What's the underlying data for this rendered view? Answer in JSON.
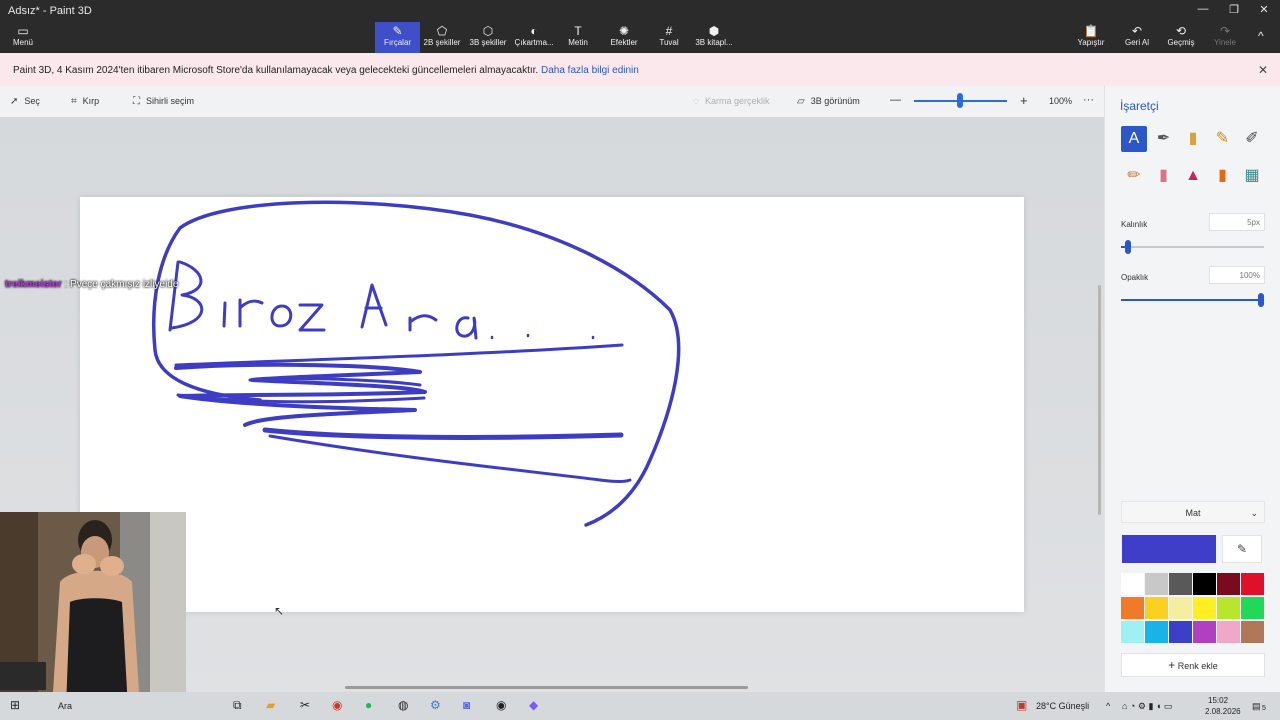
{
  "window": {
    "title": "Adsız* - Paint 3D",
    "minimize": "—",
    "maximize": "❐",
    "close": "✕"
  },
  "ribbon": {
    "menu": {
      "label": "Menü",
      "icon": "folder-icon"
    },
    "tools": [
      {
        "label": "Fırçalar",
        "icon": "brush-icon",
        "glyph": "✎",
        "active": true
      },
      {
        "label": "2B şekiller",
        "icon": "shapes-2d-icon",
        "glyph": "⬠",
        "active": false
      },
      {
        "label": "3B şekiller",
        "icon": "cube-icon",
        "glyph": "⬡",
        "active": false
      },
      {
        "label": "Çıkartma...",
        "icon": "sticker-icon",
        "glyph": "◐",
        "active": false
      },
      {
        "label": "Metin",
        "icon": "text-icon",
        "glyph": "T",
        "active": false
      },
      {
        "label": "Efektler",
        "icon": "effects-icon",
        "glyph": "✺",
        "active": false
      },
      {
        "label": "Tuval",
        "icon": "canvas-icon",
        "glyph": "#",
        "active": false
      },
      {
        "label": "3B kitapl...",
        "icon": "library-3d-icon",
        "glyph": "⬢",
        "active": false
      }
    ],
    "right": [
      {
        "label": "Yapıştır",
        "icon": "paste-icon",
        "glyph": "📋"
      },
      {
        "label": "Geri Al",
        "icon": "undo-icon",
        "glyph": "↶"
      },
      {
        "label": "Geçmiş",
        "icon": "history-icon",
        "glyph": "⟲"
      },
      {
        "label": "Yinele",
        "icon": "redo-icon",
        "glyph": "↷"
      }
    ],
    "collapse_icon": "^"
  },
  "banner": {
    "message": "Paint 3D, 4 Kasım 2024'ten itibaren Microsoft Store'da kullanılamayacak veya gelecekteki güncellemeleri almayacaktır.",
    "link": "Daha fazla bilgi edinin",
    "close": "✕"
  },
  "toolbar": {
    "select": "Seç",
    "crop": "Kırp",
    "magic_select": "Sihirli seçim",
    "mixed_reality": "Karma gerçeklik",
    "view_3d": "3B görünüm",
    "zoom_out": "—",
    "zoom_in": "+",
    "zoom_value": "100%",
    "zoom_fraction": 0.46,
    "more": "···"
  },
  "canvas": {
    "drawing_text": "Biroz Ara....",
    "stroke_color": "#3d3dc4"
  },
  "chat_overlay": {
    "user": "treikmeister",
    "message": ": Pveçe çakmışız izliyeide"
  },
  "sidepanel": {
    "title": "İşaretçi",
    "brushes": [
      {
        "name": "marker-brush-icon",
        "glyph": "A",
        "color": "#ffffff",
        "selected": true
      },
      {
        "name": "calligraphy-pen-icon",
        "glyph": "✒",
        "color": "#555555",
        "selected": false
      },
      {
        "name": "oil-brush-icon",
        "glyph": "▮",
        "color": "#d9a23a",
        "selected": false
      },
      {
        "name": "watercolor-icon",
        "glyph": "✎",
        "color": "#c98a2a",
        "selected": false
      },
      {
        "name": "pixel-pen-icon",
        "glyph": "✐",
        "color": "#444444",
        "selected": false
      },
      {
        "name": "pencil-icon",
        "glyph": "✏",
        "color": "#c47a3a",
        "selected": false
      },
      {
        "name": "eraser-icon",
        "glyph": "▮",
        "color": "#e07090",
        "selected": false
      },
      {
        "name": "crayon-icon",
        "glyph": "▲",
        "color": "#cc2255",
        "selected": false
      },
      {
        "name": "spray-can-icon",
        "glyph": "▮",
        "color": "#e06a1a",
        "selected": false
      },
      {
        "name": "fill-bucket-icon",
        "glyph": "▦",
        "color": "#3a8a8a",
        "selected": false
      }
    ],
    "thickness": {
      "label": "Kalınlık",
      "value": "5px",
      "fraction": 0.05
    },
    "opacity": {
      "label": "Opaklık",
      "value": "100%",
      "fraction": 1.0
    },
    "finish": {
      "label": "Mat",
      "chevron": "⌄"
    },
    "current_color": "#3e3ec8",
    "eyedropper": "✎",
    "palette": [
      "#ffffff",
      "#c8c8c8",
      "#595959",
      "#000000",
      "#7a0a1e",
      "#e0102a",
      "#f07a28",
      "#fbd020",
      "#f5eeA0",
      "#ffef20",
      "#b7e62a",
      "#22d858",
      "#9ff0f0",
      "#18b4e8",
      "#3c40c8",
      "#b040c0",
      "#f0a8c8",
      "#b07858"
    ],
    "add_color": "Renk ekle"
  },
  "taskbar": {
    "search": "Ara",
    "weather": "28°C  Güneşli",
    "time": "15:02",
    "date": "2.08.2026",
    "notifications": "5"
  }
}
